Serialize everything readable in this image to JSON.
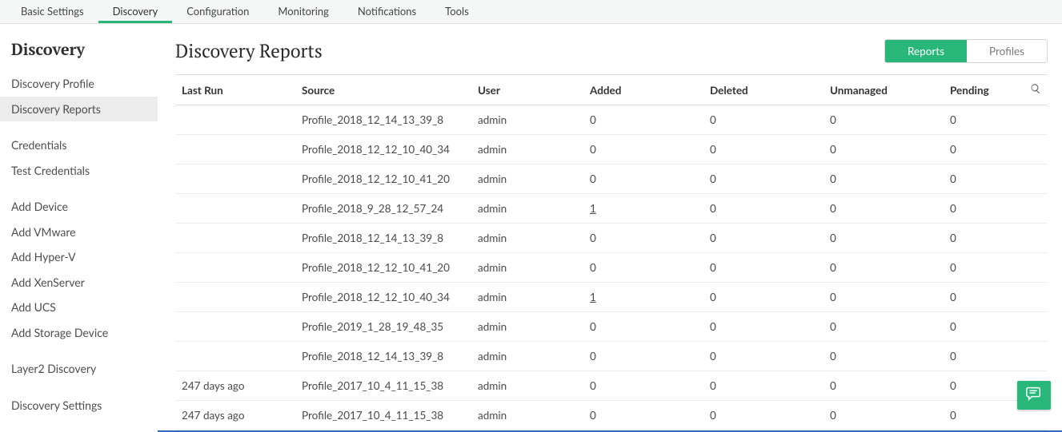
{
  "tabs": {
    "items": [
      {
        "label": "Basic Settings"
      },
      {
        "label": "Discovery"
      },
      {
        "label": "Configuration"
      },
      {
        "label": "Monitoring"
      },
      {
        "label": "Notifications"
      },
      {
        "label": "Tools"
      }
    ],
    "active_index": 1
  },
  "sidebar": {
    "title": "Discovery",
    "items": [
      {
        "label": "Discovery Profile",
        "gap_after": false
      },
      {
        "label": "Discovery Reports",
        "gap_after": true,
        "active": true
      },
      {
        "label": "Credentials",
        "gap_after": false
      },
      {
        "label": "Test Credentials",
        "gap_after": true
      },
      {
        "label": "Add Device"
      },
      {
        "label": "Add VMware"
      },
      {
        "label": "Add Hyper-V"
      },
      {
        "label": "Add XenServer"
      },
      {
        "label": "Add UCS"
      },
      {
        "label": "Add Storage Device",
        "gap_after": true
      },
      {
        "label": "Layer2 Discovery",
        "gap_after": true
      },
      {
        "label": "Discovery Settings"
      }
    ]
  },
  "main": {
    "title": "Discovery Reports",
    "toggle": {
      "reports": "Reports",
      "profiles": "Profiles",
      "active": "reports"
    }
  },
  "table": {
    "headers": {
      "last_run": "Last Run",
      "source": "Source",
      "user": "User",
      "added": "Added",
      "deleted": "Deleted",
      "unmanaged": "Unmanaged",
      "pending": "Pending"
    },
    "rows": [
      {
        "last_run": "",
        "source": "Profile_2018_12_14_13_39_8",
        "user": "admin",
        "added": "0",
        "deleted": "0",
        "unmanaged": "0",
        "pending": "0"
      },
      {
        "last_run": "",
        "source": "Profile_2018_12_12_10_40_34",
        "user": "admin",
        "added": "0",
        "deleted": "0",
        "unmanaged": "0",
        "pending": "0"
      },
      {
        "last_run": "",
        "source": "Profile_2018_12_12_10_41_20",
        "user": "admin",
        "added": "0",
        "deleted": "0",
        "unmanaged": "0",
        "pending": "0"
      },
      {
        "last_run": "",
        "source": "Profile_2018_9_28_12_57_24",
        "user": "admin",
        "added": "1",
        "added_link": true,
        "deleted": "0",
        "unmanaged": "0",
        "pending": "0"
      },
      {
        "last_run": "",
        "source": "Profile_2018_12_14_13_39_8",
        "user": "admin",
        "added": "0",
        "deleted": "0",
        "unmanaged": "0",
        "pending": "0"
      },
      {
        "last_run": "",
        "source": "Profile_2018_12_12_10_41_20",
        "user": "admin",
        "added": "0",
        "deleted": "0",
        "unmanaged": "0",
        "pending": "0"
      },
      {
        "last_run": "",
        "source": "Profile_2018_12_12_10_40_34",
        "user": "admin",
        "added": "1",
        "added_link": true,
        "deleted": "0",
        "unmanaged": "0",
        "pending": "0"
      },
      {
        "last_run": "",
        "source": "Profile_2019_1_28_19_48_35",
        "user": "admin",
        "added": "0",
        "deleted": "0",
        "unmanaged": "0",
        "pending": "0"
      },
      {
        "last_run": "",
        "source": "Profile_2018_12_14_13_39_8",
        "user": "admin",
        "added": "0",
        "deleted": "0",
        "unmanaged": "0",
        "pending": "0"
      },
      {
        "last_run": "247 days ago",
        "source": "Profile_2017_10_4_11_15_38",
        "user": "admin",
        "added": "0",
        "deleted": "0",
        "unmanaged": "0",
        "pending": "0"
      },
      {
        "last_run": "247 days ago",
        "source": "Profile_2017_10_4_11_15_38",
        "user": "admin",
        "added": "0",
        "deleted": "0",
        "unmanaged": "0",
        "pending": "0"
      }
    ]
  }
}
